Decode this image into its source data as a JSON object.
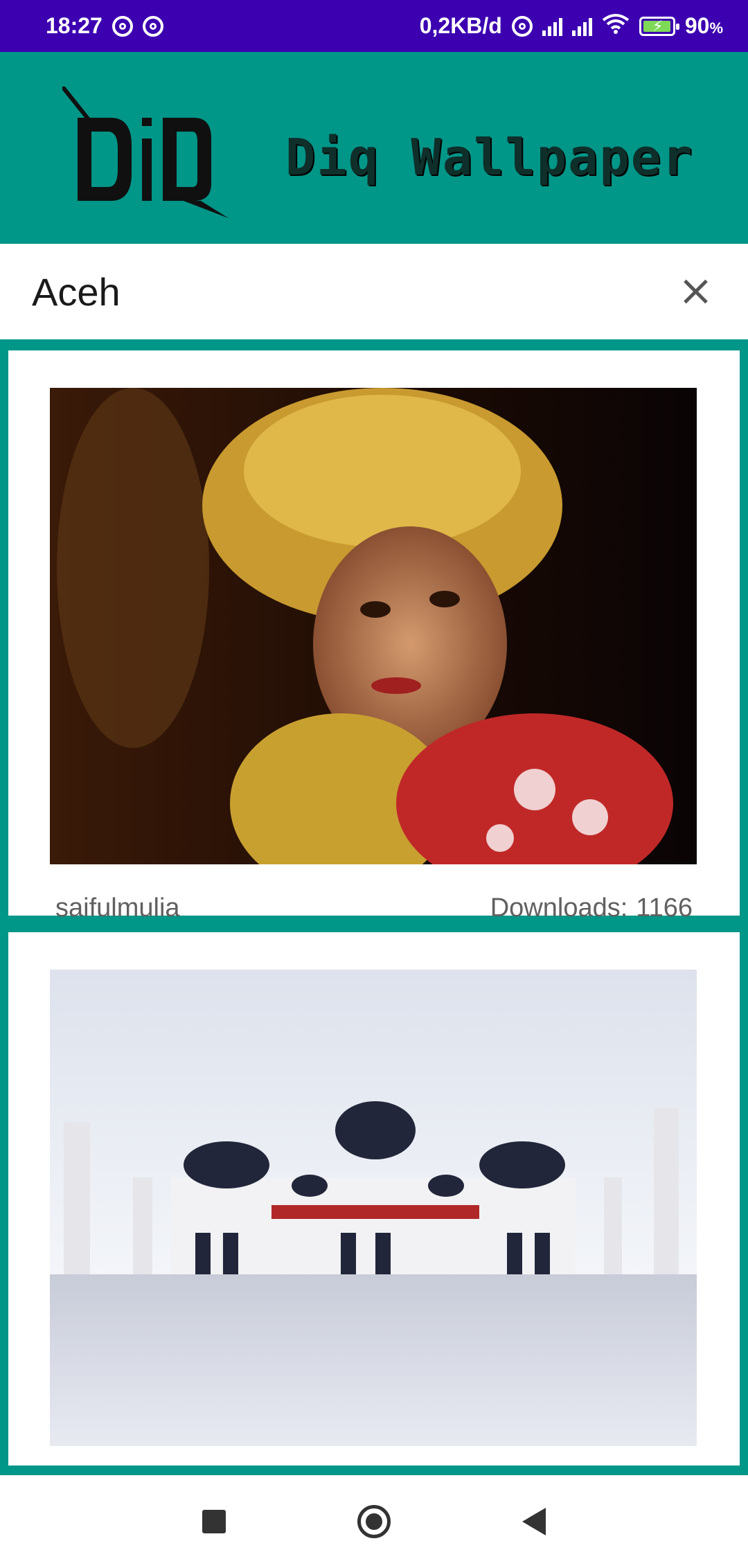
{
  "status_bar": {
    "time": "18:27",
    "network_speed": "0,2KB/d",
    "battery_percent": "90",
    "battery_unit": "%"
  },
  "app_bar": {
    "logo_text": "DiQ",
    "title": "Diq Wallpaper",
    "background_color": "#009688"
  },
  "search": {
    "query": "Aceh"
  },
  "results": [
    {
      "author": "saifulmulia",
      "downloads_label": "Downloads:",
      "downloads_count": "1166"
    },
    {
      "author": "",
      "downloads_label": "",
      "downloads_count": ""
    }
  ],
  "icons": {
    "clear": "close-icon",
    "nav_recents": "square-icon",
    "nav_home": "circle-icon",
    "nav_back": "triangle-back-icon"
  }
}
